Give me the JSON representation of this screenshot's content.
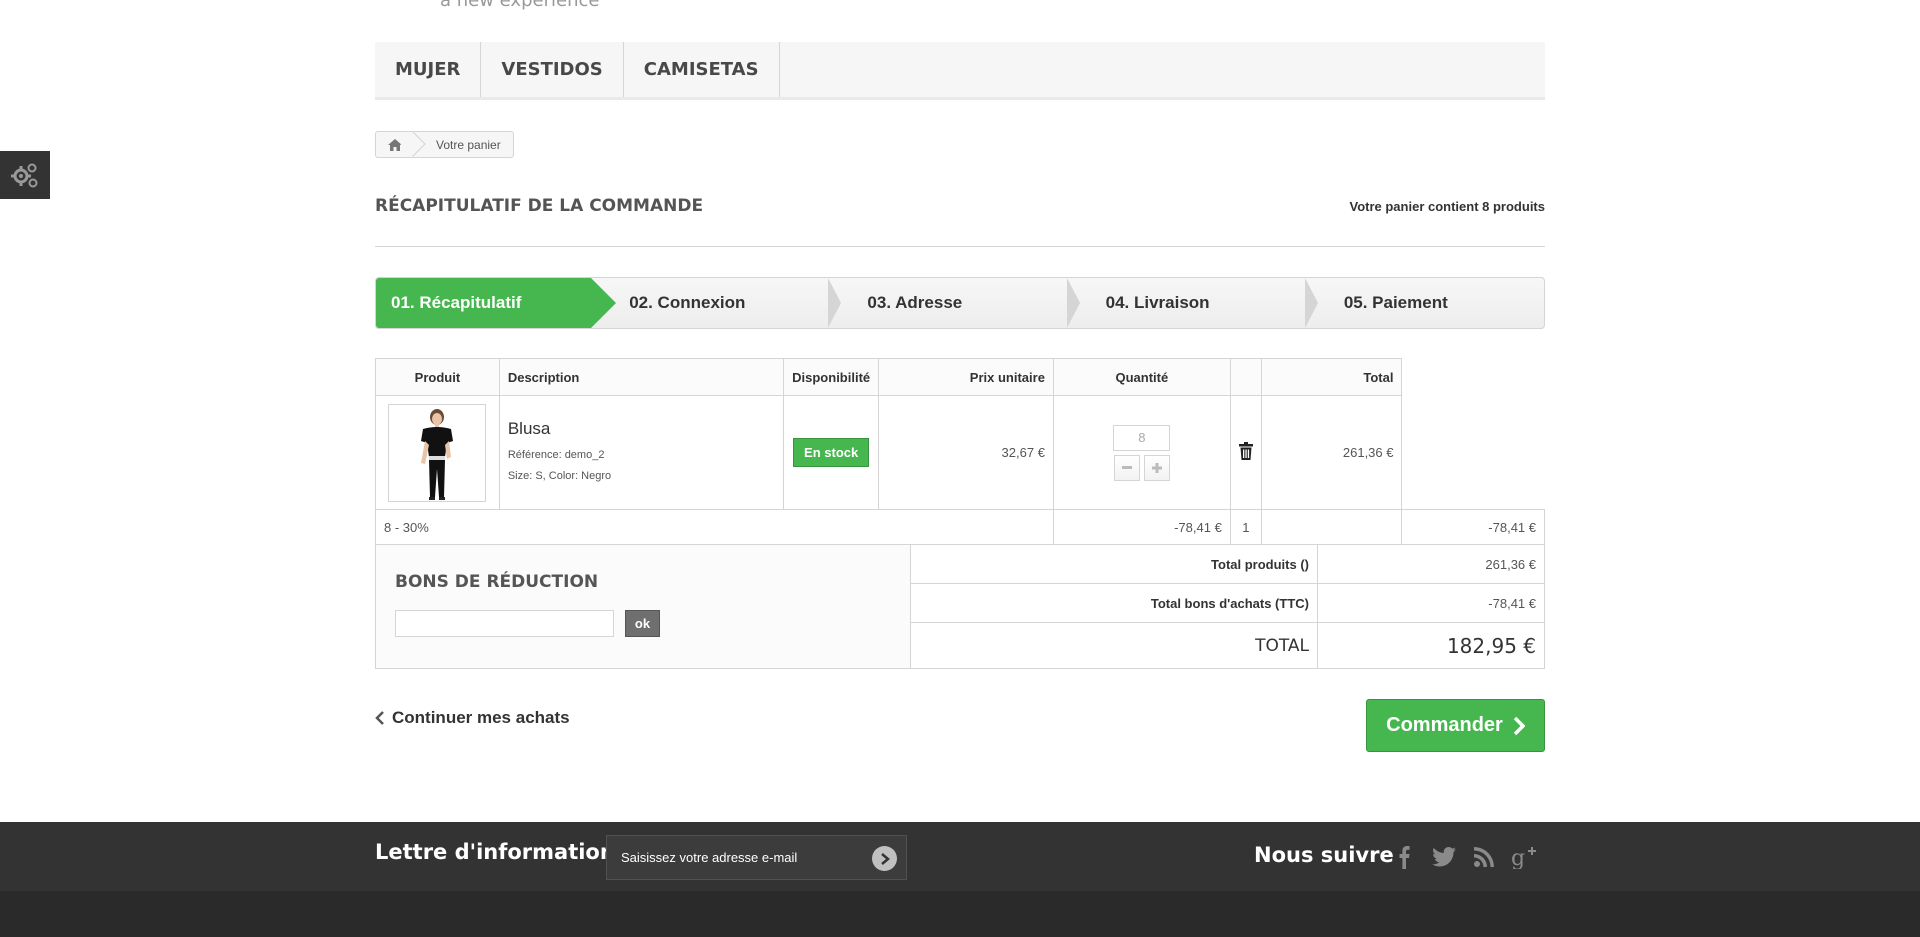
{
  "header": {
    "tagline": "a new experience"
  },
  "menu": {
    "items": [
      "MUJER",
      "VESTIDOS",
      "CAMISETAS"
    ]
  },
  "breadcrumb": {
    "current": "Votre panier"
  },
  "heading": {
    "title": "RÉCAPITULATIF DE LA COMMANDE",
    "cart_count": "Votre panier contient 8 produits"
  },
  "steps": [
    "01. Récapitulatif",
    "02. Connexion",
    "03. Adresse",
    "04. Livraison",
    "05. Paiement"
  ],
  "cart_table": {
    "headers": [
      "Produit",
      "Description",
      "Disponibilité",
      "Prix unitaire",
      "Quantité",
      "",
      "Total"
    ],
    "product": {
      "name": "Blusa",
      "reference": "Référence: demo_2",
      "attributes": "Size: S, Color: Negro",
      "availability": "En stock",
      "unit_price": "32,67 €",
      "quantity": "8",
      "total": "261,36 €"
    },
    "discount": {
      "label": "8 - 30%",
      "unit_price": "-78,41 €",
      "quantity": "1",
      "total": "-78,41 €"
    }
  },
  "vouchers": {
    "title": "BONS DE RÉDUCTION",
    "button": "ok"
  },
  "totals": {
    "products_label": "Total produits ()",
    "products_value": "261,36 €",
    "vouchers_label": "Total bons d'achats (TTC)",
    "vouchers_value": "-78,41 €",
    "total_label": "TOTAL",
    "total_value": "182,95 €"
  },
  "actions": {
    "continue": "Continuer mes achats",
    "order": "Commander"
  },
  "footer": {
    "newsletter_title": "Lettre d'informations",
    "newsletter_placeholder": "Saisissez votre adresse e-mail",
    "follow_title": "Nous suivre",
    "socials": [
      "facebook-icon",
      "twitter-icon",
      "rss-icon",
      "google-plus-icon"
    ]
  },
  "colors": {
    "accent": "#46b74e",
    "footer": "#333333"
  }
}
